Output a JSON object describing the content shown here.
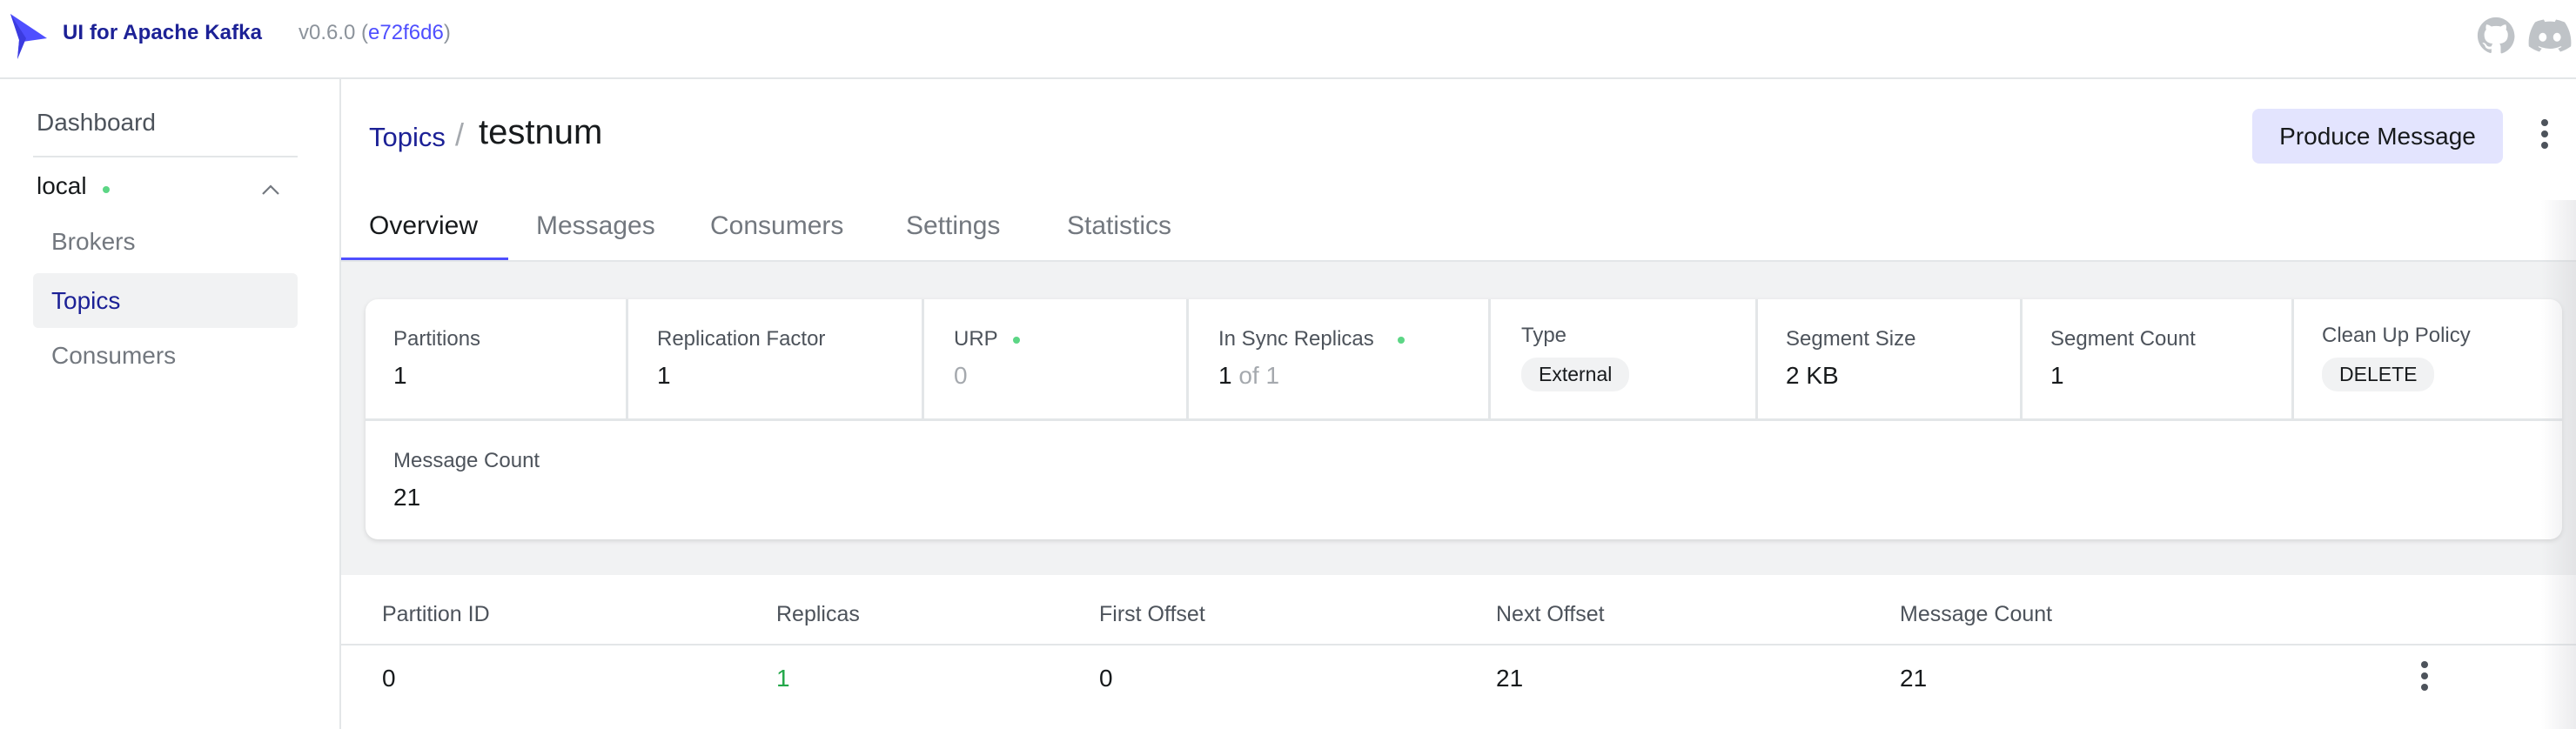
{
  "navbar": {
    "brand": "UI for Apache Kafka",
    "version_prefix": "v0.6.0 (",
    "version_hash": "e72f6d6",
    "version_suffix": ")",
    "icons": [
      "github-icon",
      "discord-icon"
    ]
  },
  "sidebar": {
    "dashboard": "Dashboard",
    "cluster": "local",
    "items": [
      {
        "label": "Brokers",
        "active": false
      },
      {
        "label": "Topics",
        "active": true
      },
      {
        "label": "Consumers",
        "active": false
      }
    ]
  },
  "header": {
    "breadcrumb_link": "Topics",
    "breadcrumb_sep": "/",
    "title": "testnum",
    "produce_button": "Produce Message"
  },
  "tabs": [
    {
      "label": "Overview",
      "active": true
    },
    {
      "label": "Messages"
    },
    {
      "label": "Consumers"
    },
    {
      "label": "Settings"
    },
    {
      "label": "Statistics"
    }
  ],
  "metrics": {
    "partitions": {
      "label": "Partitions",
      "value": "1"
    },
    "replication_factor": {
      "label": "Replication Factor",
      "value": "1"
    },
    "urp": {
      "label": "URP",
      "value": "0"
    },
    "in_sync": {
      "label": "In Sync Replicas",
      "value": "1",
      "suffix": " of 1"
    },
    "type": {
      "label": "Type",
      "value": "External"
    },
    "segment_size": {
      "label": "Segment Size",
      "value": "2 KB"
    },
    "segment_count": {
      "label": "Segment Count",
      "value": "1"
    },
    "cleanup_policy": {
      "label": "Clean Up Policy",
      "value": "DELETE"
    },
    "message_count": {
      "label": "Message Count",
      "value": "21"
    }
  },
  "table": {
    "headers": [
      "Partition ID",
      "Replicas",
      "First Offset",
      "Next Offset",
      "Message Count"
    ],
    "rows": [
      [
        "0",
        "1",
        "0",
        "21",
        "21"
      ]
    ]
  },
  "colors": {
    "brand": "#1c2196",
    "accent": "#4f4fff",
    "ok": "#5cd685",
    "replica_green": "#23a84a"
  }
}
